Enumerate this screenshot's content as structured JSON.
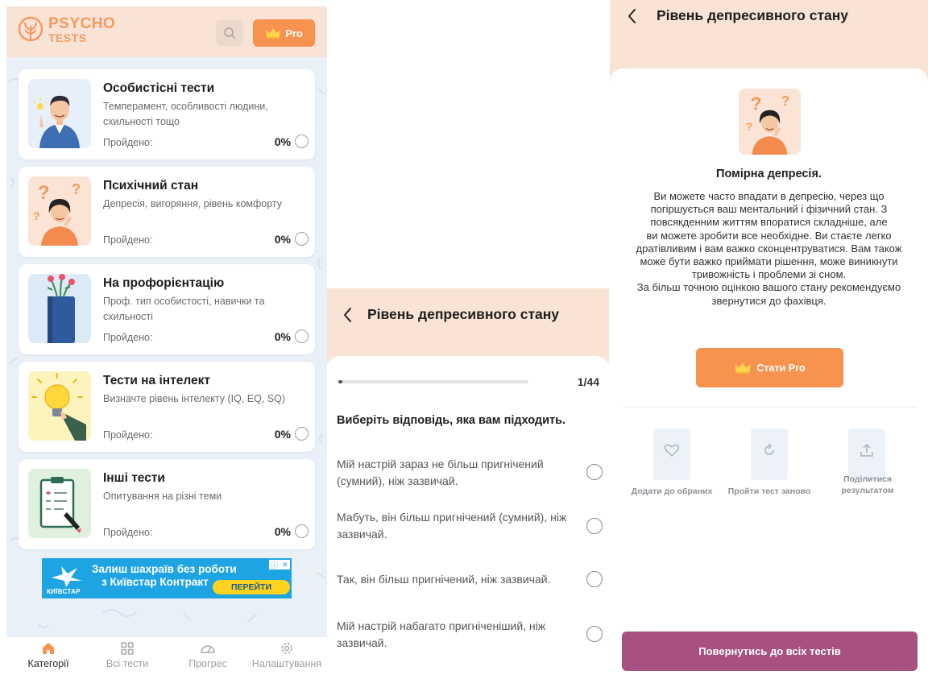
{
  "screen1": {
    "logo": {
      "line1": "PSYCHO",
      "line2": "TESTS"
    },
    "pro_label": "Pro",
    "categories": [
      {
        "title": "Особистісні тести",
        "description": "Темперамент, особливості людини, схильності тощо",
        "passed_label": "Пройдено:",
        "percent": "0%"
      },
      {
        "title": "Психічний стан",
        "description": "Депресія, вигоряння, рівень комфорту",
        "passed_label": "Пройдено:",
        "percent": "0%"
      },
      {
        "title": "На профорієнтацію",
        "description": "Проф. тип особистості, навички та схильності",
        "passed_label": "Пройдено:",
        "percent": "0%"
      },
      {
        "title": "Тести на інтелект",
        "description": "Визначте рівень інтелекту (IQ, EQ, SQ)",
        "passed_label": "Пройдено:",
        "percent": "0%"
      },
      {
        "title": "Інші тести",
        "description": "Опитування на різні теми",
        "passed_label": "Пройдено:",
        "percent": "0%"
      }
    ],
    "ad": {
      "line1": "Залиш шахраїв без роботи",
      "line2": "з Київстар Контракт",
      "cta": "ПЕРЕЙТИ",
      "brand": "КИЇВСТАР"
    },
    "tabs": [
      {
        "label": "Категорії"
      },
      {
        "label": "Всі тести"
      },
      {
        "label": "Прогрес"
      },
      {
        "label": "Налаштування"
      }
    ]
  },
  "screen2": {
    "title": "Рівень депресивного стану",
    "progress_text": "1/44",
    "progress_fraction": 0.023,
    "question": "Виберіть відповідь, яка вам підходить.",
    "answers": [
      "Мій настрій зараз не більш пригнічений (сумний), ніж зазвичай.",
      "Мабуть, він більш пригнічений (сумний), ніж зазвичай.",
      "Так, він більш пригнічений, ніж зазвичай.",
      "Мій настрій набагато пригніченіший, ніж зазвичай."
    ]
  },
  "screen3": {
    "title": "Рівень депресивного стану",
    "result_title": "Помірна депресія.",
    "result_lines": [
      "Ви можете часто впадати в депресію, через що",
      "погіршується ваш ментальний і фізичний стан. З",
      "повсякденним життям впоратися складніше, але",
      "ви можете зробити все необхідне. Ви стаєте легко",
      "дратівливим і вам важко сконцентруватися. Вам також",
      "може бути важко приймати рішення, може виникнути",
      "тривожність і проблеми зі сном.",
      "За більш точною оцінкою вашого стану рекомендуємо",
      "звернутися до фахівця."
    ],
    "pro_button": "Стати Pro",
    "actions": [
      {
        "label_lines": [
          "Додати до обраних"
        ]
      },
      {
        "label_lines": [
          "Пройти тест заново"
        ]
      },
      {
        "label_lines": [
          "Поділитися",
          "результатом"
        ]
      }
    ],
    "back_button": "Повернутись до всіх тестів"
  },
  "colors": {
    "header_peach": "#f8e3d5",
    "accent_orange": "#f7924f",
    "list_background": "#eaf0f7",
    "back_button_purple": "#a8507f",
    "ad_blue": "#1fa4e3",
    "ad_yellow": "#ffd21e"
  }
}
